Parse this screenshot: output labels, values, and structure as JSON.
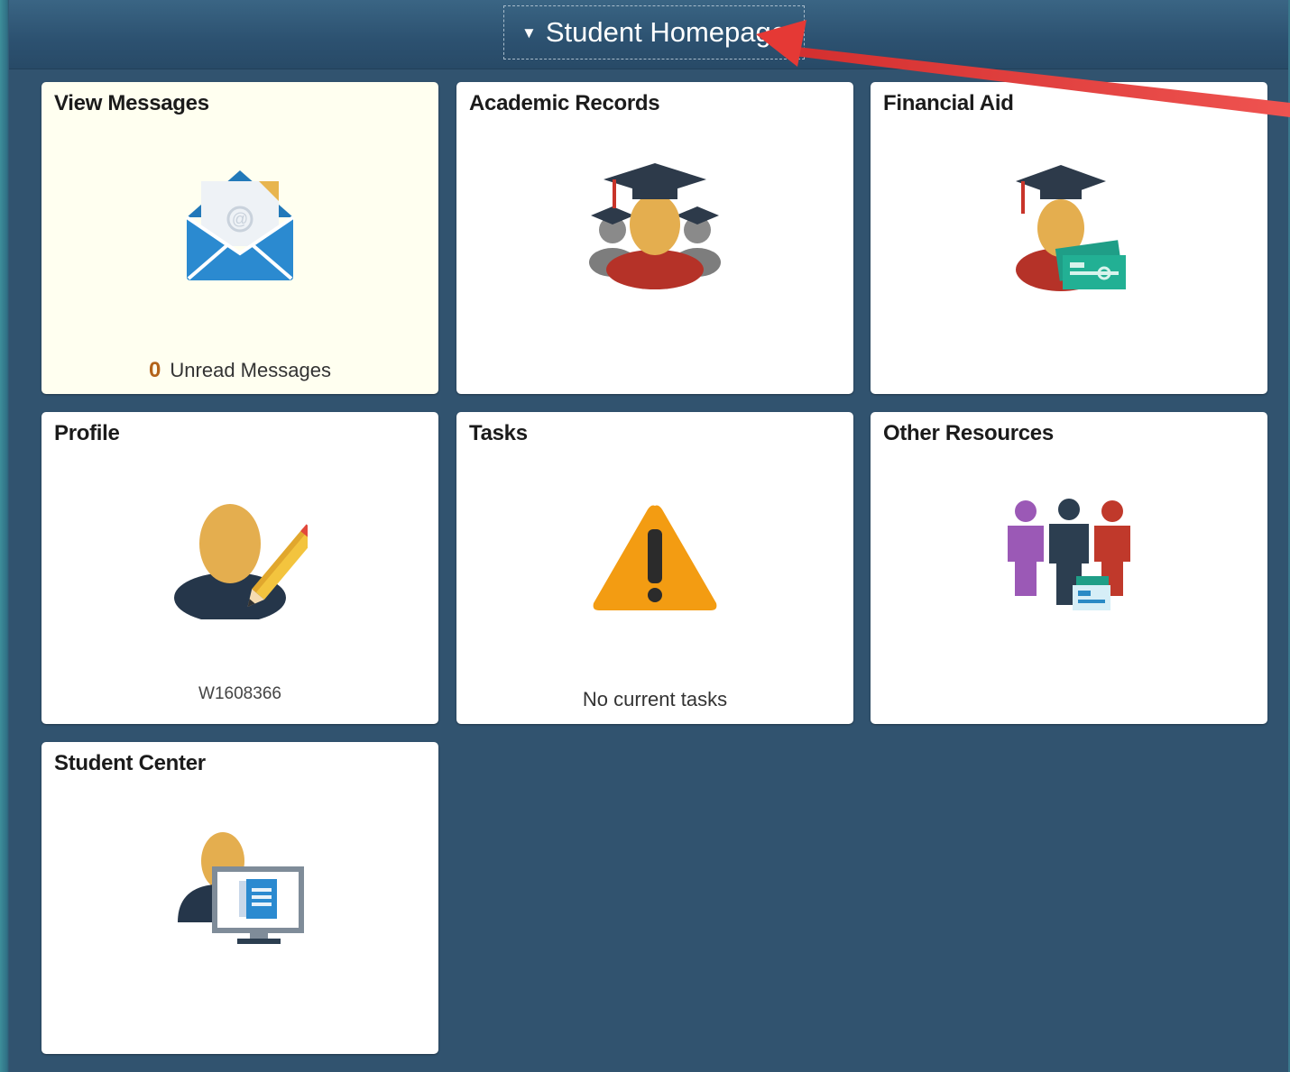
{
  "header": {
    "homepage_selector_label": "Student Homepage",
    "caret_glyph": "▼"
  },
  "tiles": [
    {
      "title": "View Messages",
      "icon": "envelope-icon",
      "count": "0",
      "footer": "Unread Messages"
    },
    {
      "title": "Academic Records",
      "icon": "graduates-icon"
    },
    {
      "title": "Financial Aid",
      "icon": "graduate-money-icon"
    },
    {
      "title": "Profile",
      "icon": "user-edit-icon",
      "footer": "W1608366"
    },
    {
      "title": "Tasks",
      "icon": "warning-icon",
      "footer": "No current tasks"
    },
    {
      "title": "Other Resources",
      "icon": "people-group-icon"
    },
    {
      "title": "Student Center",
      "icon": "user-monitor-icon"
    }
  ],
  "colors": {
    "background": "#31536f",
    "highlight_tile": "#fffff0",
    "annotation_arrow": "#e53935"
  }
}
